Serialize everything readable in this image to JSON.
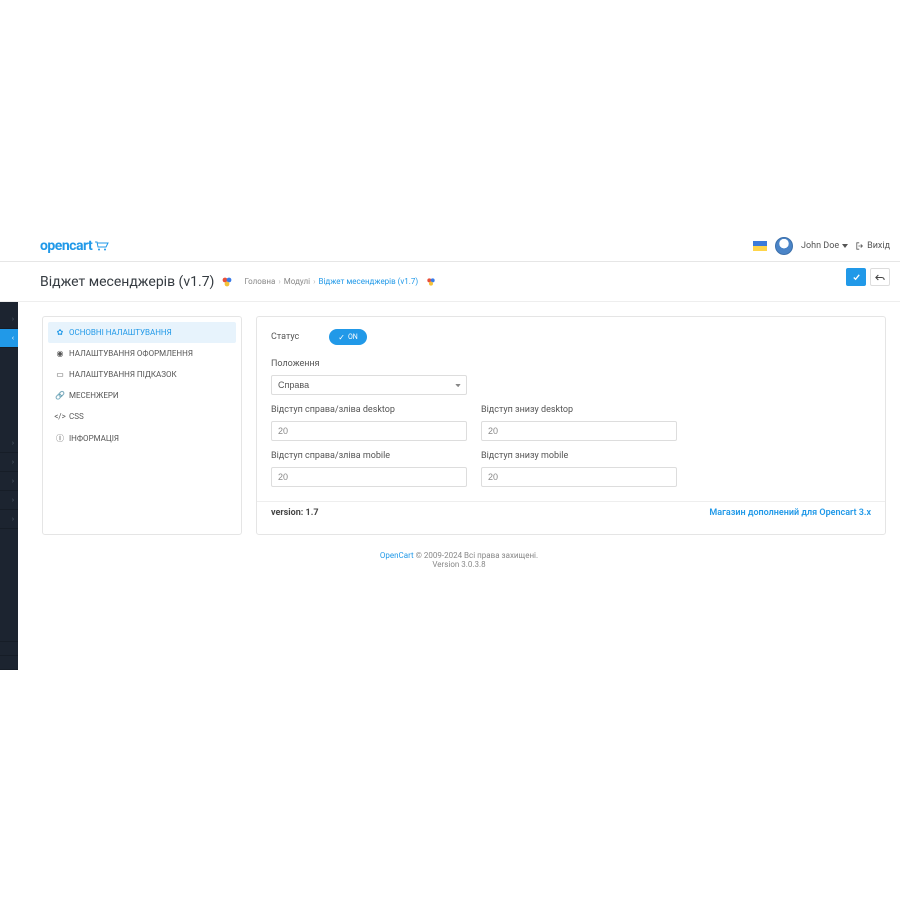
{
  "header": {
    "logo_text": "opencart",
    "user_name": "John Doe",
    "exit_label": "Вихід"
  },
  "page": {
    "title": "Віджет месенджерів (v1.7)",
    "breadcrumb": {
      "home": "Головна",
      "modules": "Модулі",
      "current": "Віджет месенджерів (v1.7)"
    }
  },
  "tabs": [
    {
      "label": "Основні налаштування",
      "icon": "gear",
      "active": true
    },
    {
      "label": "Налаштування оформлення",
      "icon": "eye",
      "active": false
    },
    {
      "label": "Налаштування підказок",
      "icon": "chat",
      "active": false
    },
    {
      "label": "Месенжери",
      "icon": "link",
      "active": false
    },
    {
      "label": "CSS",
      "icon": "code",
      "active": false
    },
    {
      "label": "Інформація",
      "icon": "info",
      "active": false
    }
  ],
  "form": {
    "status_label": "Статус",
    "status_on": "ON",
    "position_label": "Положення",
    "position_value": "Справа",
    "margin_side_desktop_label": "Відступ справа/зліва desktop",
    "margin_side_desktop_value": "20",
    "margin_bottom_desktop_label": "Відступ знизу desktop",
    "margin_bottom_desktop_value": "20",
    "margin_side_mobile_label": "Відступ справа/зліва mobile",
    "margin_side_mobile_value": "20",
    "margin_bottom_mobile_label": "Відступ знизу mobile",
    "margin_bottom_mobile_value": "20"
  },
  "panel_footer": {
    "version_label": "version: 1.7",
    "store_link": "Магазин дополнений для Opencart 3.x"
  },
  "footer": {
    "brand": "OpenCart",
    "copyright": " © 2009-2024 Всі права захищені.",
    "version": "Version 3.0.3.8"
  }
}
